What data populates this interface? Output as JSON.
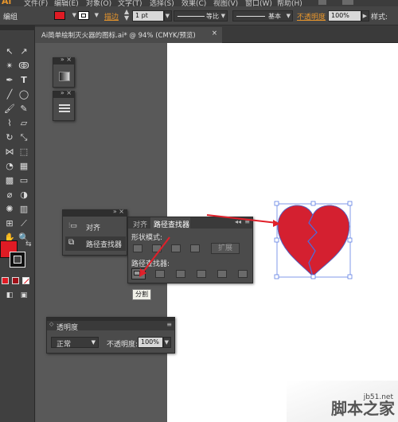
{
  "menubar": {
    "logo": "Ai",
    "items": [
      "文件(F)",
      "编辑(E)",
      "对象(O)",
      "文字(T)",
      "选择(S)",
      "效果(C)",
      "视图(V)",
      "窗口(W)",
      "帮助(H)"
    ]
  },
  "control_bar": {
    "group_label": "编组",
    "stroke_label": "描边",
    "stroke_value": "1 pt",
    "profile_label": "等比",
    "brush_label": "基本",
    "opacity_label": "不透明度",
    "opacity_value": "100%",
    "style_label": "样式:"
  },
  "document_tab": {
    "title": "Ai简单绘制灭火器的图标.ai* @ 94% (CMYK/预览)",
    "close": "×"
  },
  "align_panel": {
    "items": [
      {
        "label": "对齐",
        "icon": "align-icon"
      },
      {
        "label": "路径查找器",
        "icon": "pathfinder-icon"
      }
    ]
  },
  "pathfinder_panel": {
    "tabs": [
      "对齐",
      "路径查找器"
    ],
    "active_tab": 1,
    "shape_modes_label": "形状模式:",
    "expand_label": "扩展",
    "pathfinders_label": "路径查找器:",
    "tooltip": "分割"
  },
  "transparency_panel": {
    "title": "透明度",
    "blend_mode": "正常",
    "opacity_label": "不透明度:",
    "opacity_value": "100%"
  },
  "watermark": {
    "site": "jb51.net",
    "brand": "脚本之家"
  },
  "colors": {
    "heart_fill": "#d42030",
    "selection": "#4a6fe0",
    "arrow": "#e0202a",
    "fill_swatch": "#e01b24"
  }
}
